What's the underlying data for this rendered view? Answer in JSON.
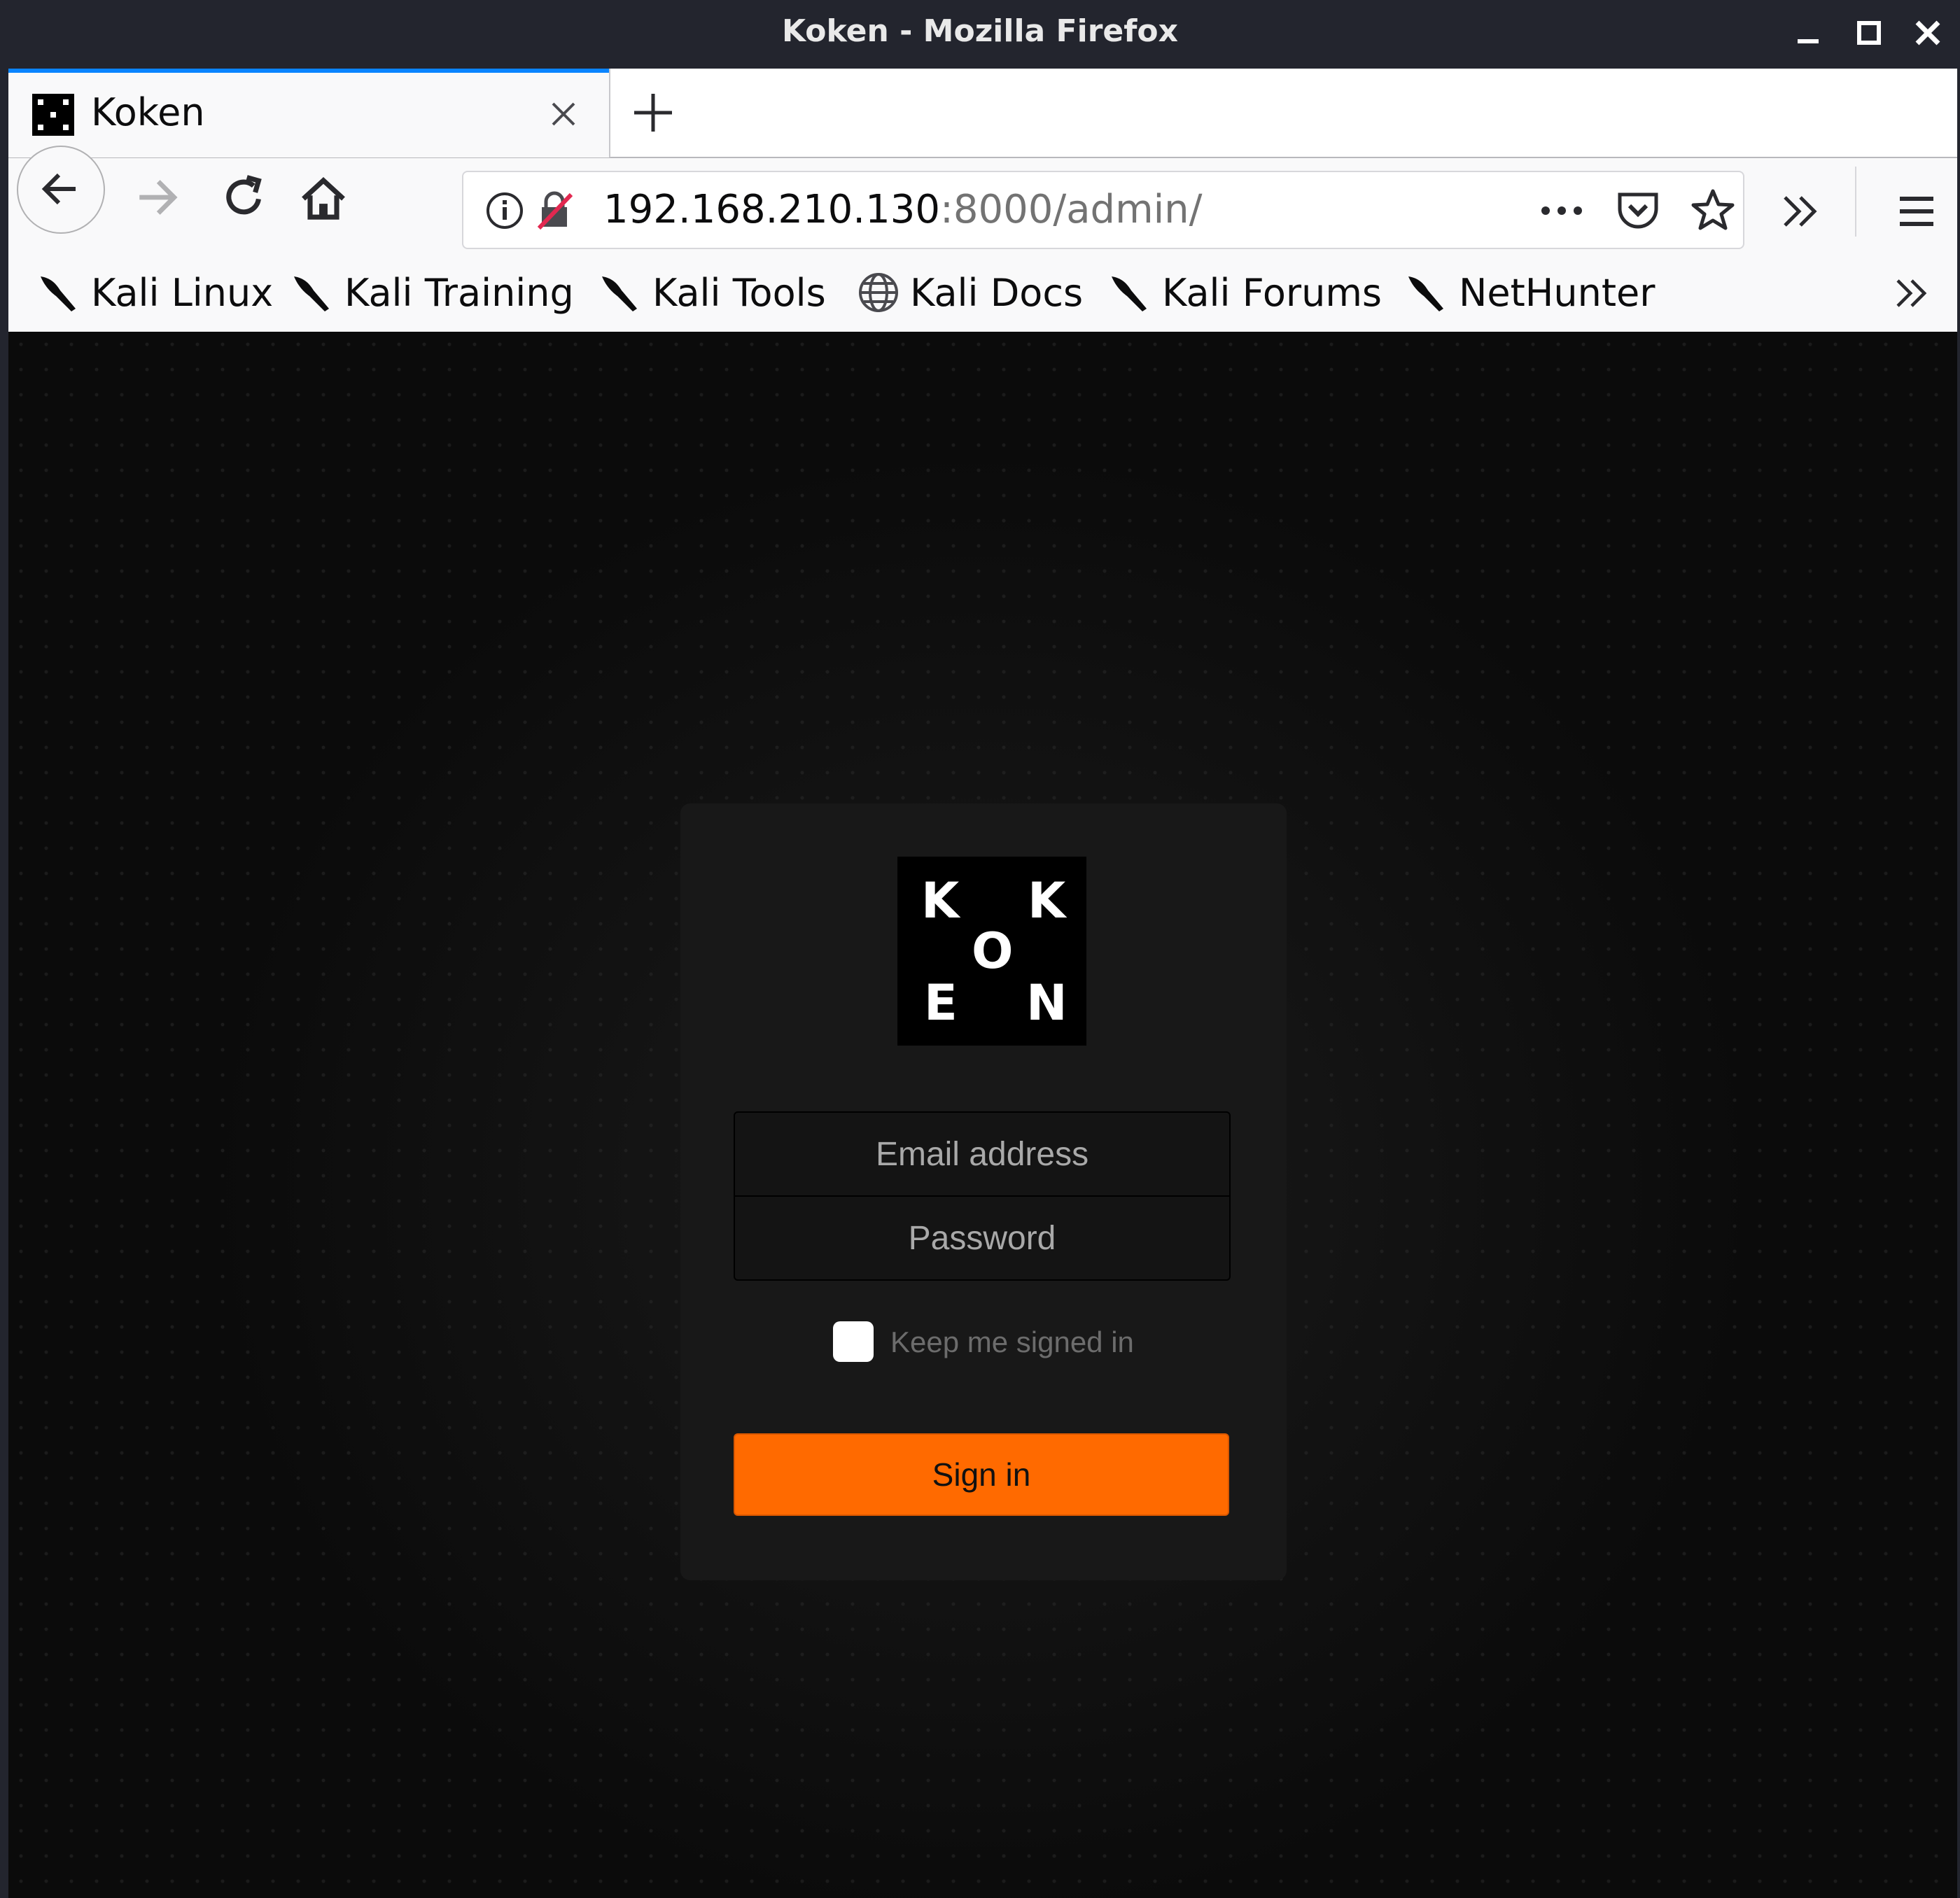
{
  "window": {
    "title": "Koken - Mozilla Firefox"
  },
  "tab": {
    "title": "Koken"
  },
  "urlbar": {
    "host": "192.168.210.130",
    "rest": ":8000/admin/"
  },
  "bookmarks": [
    {
      "label": "Kali Linux",
      "icon": "kali-dragon-icon"
    },
    {
      "label": "Kali Training",
      "icon": "kali-dragon-icon"
    },
    {
      "label": "Kali Tools",
      "icon": "kali-dragon-icon"
    },
    {
      "label": "Kali Docs",
      "icon": "globe-icon"
    },
    {
      "label": "Kali Forums",
      "icon": "kali-dragon-icon"
    },
    {
      "label": "NetHunter",
      "icon": "kali-dragon-icon"
    }
  ],
  "login": {
    "logo_letters": [
      "K",
      "K",
      "O",
      "E",
      "N"
    ],
    "email_placeholder": "Email address",
    "password_placeholder": "Password",
    "keep_signed_in": "Keep me signed in",
    "submit": "Sign in"
  },
  "colors": {
    "accent": "#ff6a00",
    "tab_indicator": "#0a84ff",
    "titlebar": "#23252e"
  }
}
